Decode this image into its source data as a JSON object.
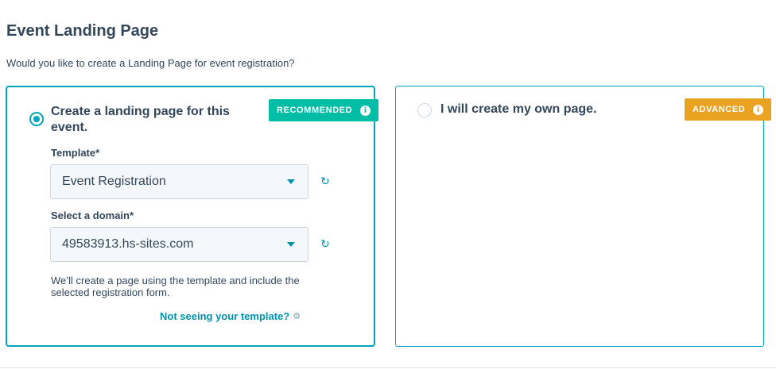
{
  "header": {
    "title": "Event Landing Page",
    "subtitle": "Would you like to create a Landing Page for event registration?"
  },
  "options": [
    {
      "label": "Create a landing page for this event.",
      "selected": true,
      "badge": "RECOMMENDED",
      "badge_color": "#00bda5",
      "template_label": "Template*",
      "template_value": "Event Registration",
      "domain_label": "Select a domain*",
      "domain_value": "49583913.hs-sites.com",
      "help_text": "We’ll create a page using the template and include the selected registration form.",
      "help_link": "Not seeing your template?"
    },
    {
      "label": "I will create my own page.",
      "selected": false,
      "badge": "ADVANCED",
      "badge_color": "#eaa221"
    }
  ],
  "icons": {
    "info": "info-icon",
    "refresh": "refresh-icon",
    "caret": "chevron-down-icon",
    "gear": "gear-icon"
  },
  "colors": {
    "accent": "#00a4bd",
    "link": "#0091ae",
    "text": "#33475b"
  }
}
